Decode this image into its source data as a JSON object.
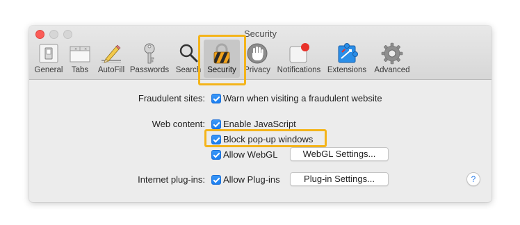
{
  "window": {
    "title": "Security"
  },
  "toolbar": {
    "tabs": [
      {
        "label": "General",
        "icon": "general-switch-icon"
      },
      {
        "label": "Tabs",
        "icon": "tabs-icon"
      },
      {
        "label": "AutoFill",
        "icon": "autofill-pencil-icon"
      },
      {
        "label": "Passwords",
        "icon": "key-icon"
      },
      {
        "label": "Search",
        "icon": "magnifier-icon"
      },
      {
        "label": "Security",
        "icon": "padlock-icon",
        "selected": true
      },
      {
        "label": "Privacy",
        "icon": "hand-icon"
      },
      {
        "label": "Notifications",
        "icon": "notification-badge-icon"
      },
      {
        "label": "Extensions",
        "icon": "puzzle-piece-icon"
      },
      {
        "label": "Advanced",
        "icon": "gear-icon"
      }
    ]
  },
  "content": {
    "fraudulent": {
      "label": "Fraudulent sites:",
      "option": "Warn when visiting a fraudulent website",
      "checked": true
    },
    "web_content": {
      "label": "Web content:",
      "javascript": "Enable JavaScript",
      "popups": "Block pop-up windows",
      "webgl": "Allow WebGL",
      "webgl_button": "WebGL Settings..."
    },
    "plugins": {
      "label": "Internet plug-ins:",
      "option": "Allow Plug-ins",
      "button": "Plug-in Settings..."
    },
    "help": "?"
  },
  "colors": {
    "highlight": "#f4b41a",
    "checkbox": "#1a7ef0",
    "close": "#fb5c57"
  }
}
